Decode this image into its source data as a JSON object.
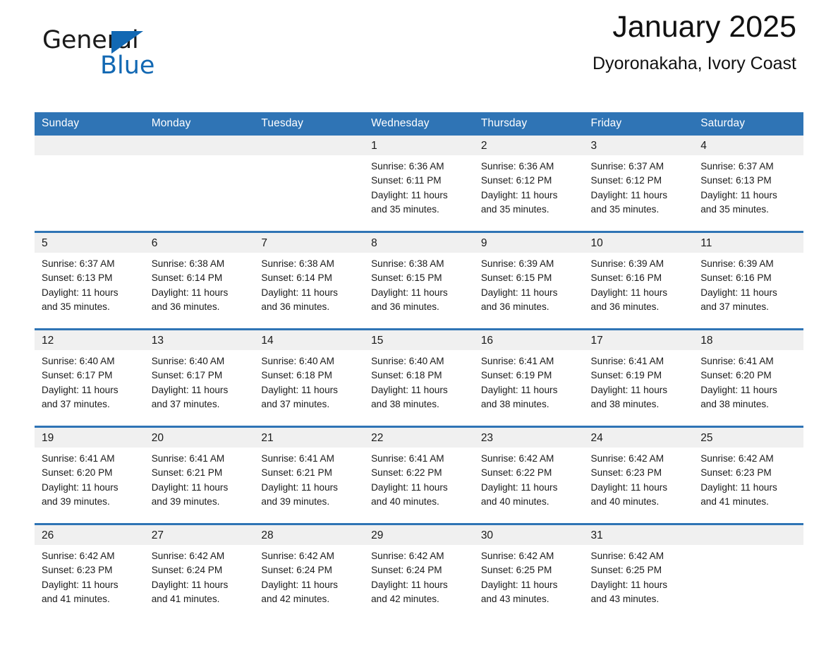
{
  "brand": {
    "name_part1": "General",
    "name_part2": "Blue",
    "logo_icon": "triangle-icon",
    "accent_color": "#1268b3"
  },
  "header": {
    "title": "January 2025",
    "location": "Dyoronakaha, Ivory Coast"
  },
  "calendar": {
    "header_bg": "#2f74b5",
    "daynum_bg": "#f0f0f0",
    "weekdays": [
      "Sunday",
      "Monday",
      "Tuesday",
      "Wednesday",
      "Thursday",
      "Friday",
      "Saturday"
    ],
    "weeks": [
      [
        {
          "day": "",
          "lines": []
        },
        {
          "day": "",
          "lines": []
        },
        {
          "day": "",
          "lines": []
        },
        {
          "day": "1",
          "lines": [
            "Sunrise: 6:36 AM",
            "Sunset: 6:11 PM",
            "Daylight: 11 hours",
            "and 35 minutes."
          ]
        },
        {
          "day": "2",
          "lines": [
            "Sunrise: 6:36 AM",
            "Sunset: 6:12 PM",
            "Daylight: 11 hours",
            "and 35 minutes."
          ]
        },
        {
          "day": "3",
          "lines": [
            "Sunrise: 6:37 AM",
            "Sunset: 6:12 PM",
            "Daylight: 11 hours",
            "and 35 minutes."
          ]
        },
        {
          "day": "4",
          "lines": [
            "Sunrise: 6:37 AM",
            "Sunset: 6:13 PM",
            "Daylight: 11 hours",
            "and 35 minutes."
          ]
        }
      ],
      [
        {
          "day": "5",
          "lines": [
            "Sunrise: 6:37 AM",
            "Sunset: 6:13 PM",
            "Daylight: 11 hours",
            "and 35 minutes."
          ]
        },
        {
          "day": "6",
          "lines": [
            "Sunrise: 6:38 AM",
            "Sunset: 6:14 PM",
            "Daylight: 11 hours",
            "and 36 minutes."
          ]
        },
        {
          "day": "7",
          "lines": [
            "Sunrise: 6:38 AM",
            "Sunset: 6:14 PM",
            "Daylight: 11 hours",
            "and 36 minutes."
          ]
        },
        {
          "day": "8",
          "lines": [
            "Sunrise: 6:38 AM",
            "Sunset: 6:15 PM",
            "Daylight: 11 hours",
            "and 36 minutes."
          ]
        },
        {
          "day": "9",
          "lines": [
            "Sunrise: 6:39 AM",
            "Sunset: 6:15 PM",
            "Daylight: 11 hours",
            "and 36 minutes."
          ]
        },
        {
          "day": "10",
          "lines": [
            "Sunrise: 6:39 AM",
            "Sunset: 6:16 PM",
            "Daylight: 11 hours",
            "and 36 minutes."
          ]
        },
        {
          "day": "11",
          "lines": [
            "Sunrise: 6:39 AM",
            "Sunset: 6:16 PM",
            "Daylight: 11 hours",
            "and 37 minutes."
          ]
        }
      ],
      [
        {
          "day": "12",
          "lines": [
            "Sunrise: 6:40 AM",
            "Sunset: 6:17 PM",
            "Daylight: 11 hours",
            "and 37 minutes."
          ]
        },
        {
          "day": "13",
          "lines": [
            "Sunrise: 6:40 AM",
            "Sunset: 6:17 PM",
            "Daylight: 11 hours",
            "and 37 minutes."
          ]
        },
        {
          "day": "14",
          "lines": [
            "Sunrise: 6:40 AM",
            "Sunset: 6:18 PM",
            "Daylight: 11 hours",
            "and 37 minutes."
          ]
        },
        {
          "day": "15",
          "lines": [
            "Sunrise: 6:40 AM",
            "Sunset: 6:18 PM",
            "Daylight: 11 hours",
            "and 38 minutes."
          ]
        },
        {
          "day": "16",
          "lines": [
            "Sunrise: 6:41 AM",
            "Sunset: 6:19 PM",
            "Daylight: 11 hours",
            "and 38 minutes."
          ]
        },
        {
          "day": "17",
          "lines": [
            "Sunrise: 6:41 AM",
            "Sunset: 6:19 PM",
            "Daylight: 11 hours",
            "and 38 minutes."
          ]
        },
        {
          "day": "18",
          "lines": [
            "Sunrise: 6:41 AM",
            "Sunset: 6:20 PM",
            "Daylight: 11 hours",
            "and 38 minutes."
          ]
        }
      ],
      [
        {
          "day": "19",
          "lines": [
            "Sunrise: 6:41 AM",
            "Sunset: 6:20 PM",
            "Daylight: 11 hours",
            "and 39 minutes."
          ]
        },
        {
          "day": "20",
          "lines": [
            "Sunrise: 6:41 AM",
            "Sunset: 6:21 PM",
            "Daylight: 11 hours",
            "and 39 minutes."
          ]
        },
        {
          "day": "21",
          "lines": [
            "Sunrise: 6:41 AM",
            "Sunset: 6:21 PM",
            "Daylight: 11 hours",
            "and 39 minutes."
          ]
        },
        {
          "day": "22",
          "lines": [
            "Sunrise: 6:41 AM",
            "Sunset: 6:22 PM",
            "Daylight: 11 hours",
            "and 40 minutes."
          ]
        },
        {
          "day": "23",
          "lines": [
            "Sunrise: 6:42 AM",
            "Sunset: 6:22 PM",
            "Daylight: 11 hours",
            "and 40 minutes."
          ]
        },
        {
          "day": "24",
          "lines": [
            "Sunrise: 6:42 AM",
            "Sunset: 6:23 PM",
            "Daylight: 11 hours",
            "and 40 minutes."
          ]
        },
        {
          "day": "25",
          "lines": [
            "Sunrise: 6:42 AM",
            "Sunset: 6:23 PM",
            "Daylight: 11 hours",
            "and 41 minutes."
          ]
        }
      ],
      [
        {
          "day": "26",
          "lines": [
            "Sunrise: 6:42 AM",
            "Sunset: 6:23 PM",
            "Daylight: 11 hours",
            "and 41 minutes."
          ]
        },
        {
          "day": "27",
          "lines": [
            "Sunrise: 6:42 AM",
            "Sunset: 6:24 PM",
            "Daylight: 11 hours",
            "and 41 minutes."
          ]
        },
        {
          "day": "28",
          "lines": [
            "Sunrise: 6:42 AM",
            "Sunset: 6:24 PM",
            "Daylight: 11 hours",
            "and 42 minutes."
          ]
        },
        {
          "day": "29",
          "lines": [
            "Sunrise: 6:42 AM",
            "Sunset: 6:24 PM",
            "Daylight: 11 hours",
            "and 42 minutes."
          ]
        },
        {
          "day": "30",
          "lines": [
            "Sunrise: 6:42 AM",
            "Sunset: 6:25 PM",
            "Daylight: 11 hours",
            "and 43 minutes."
          ]
        },
        {
          "day": "31",
          "lines": [
            "Sunrise: 6:42 AM",
            "Sunset: 6:25 PM",
            "Daylight: 11 hours",
            "and 43 minutes."
          ]
        },
        {
          "day": "",
          "lines": []
        }
      ]
    ]
  }
}
